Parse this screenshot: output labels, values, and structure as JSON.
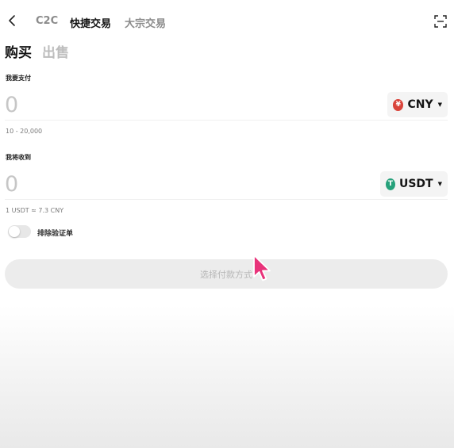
{
  "header": {
    "tabs": [
      {
        "label": "C2C",
        "active": false
      },
      {
        "label": "快捷交易",
        "active": true
      },
      {
        "label": "大宗交易",
        "active": false
      }
    ]
  },
  "trade_side": {
    "buy_label": "购买",
    "sell_label": "出售",
    "active": "buy"
  },
  "pay": {
    "label": "我要支付",
    "amount_placeholder": "0",
    "currency": "CNY",
    "currency_symbol": "¥",
    "limit_hint": "10 - 20,000"
  },
  "receive": {
    "label": "我将收到",
    "amount_placeholder": "0",
    "currency": "USDT",
    "currency_symbol": "T",
    "rate_hint": "1 USDT ≈ 7.3 CNY"
  },
  "filter": {
    "toggle_label": "排除验证单",
    "enabled": false
  },
  "action": {
    "button_label": "选择付款方式",
    "enabled": false
  },
  "colors": {
    "cny_coin": "#d9443b",
    "usdt_coin": "#26a17b",
    "cursor": "#e8337a"
  }
}
